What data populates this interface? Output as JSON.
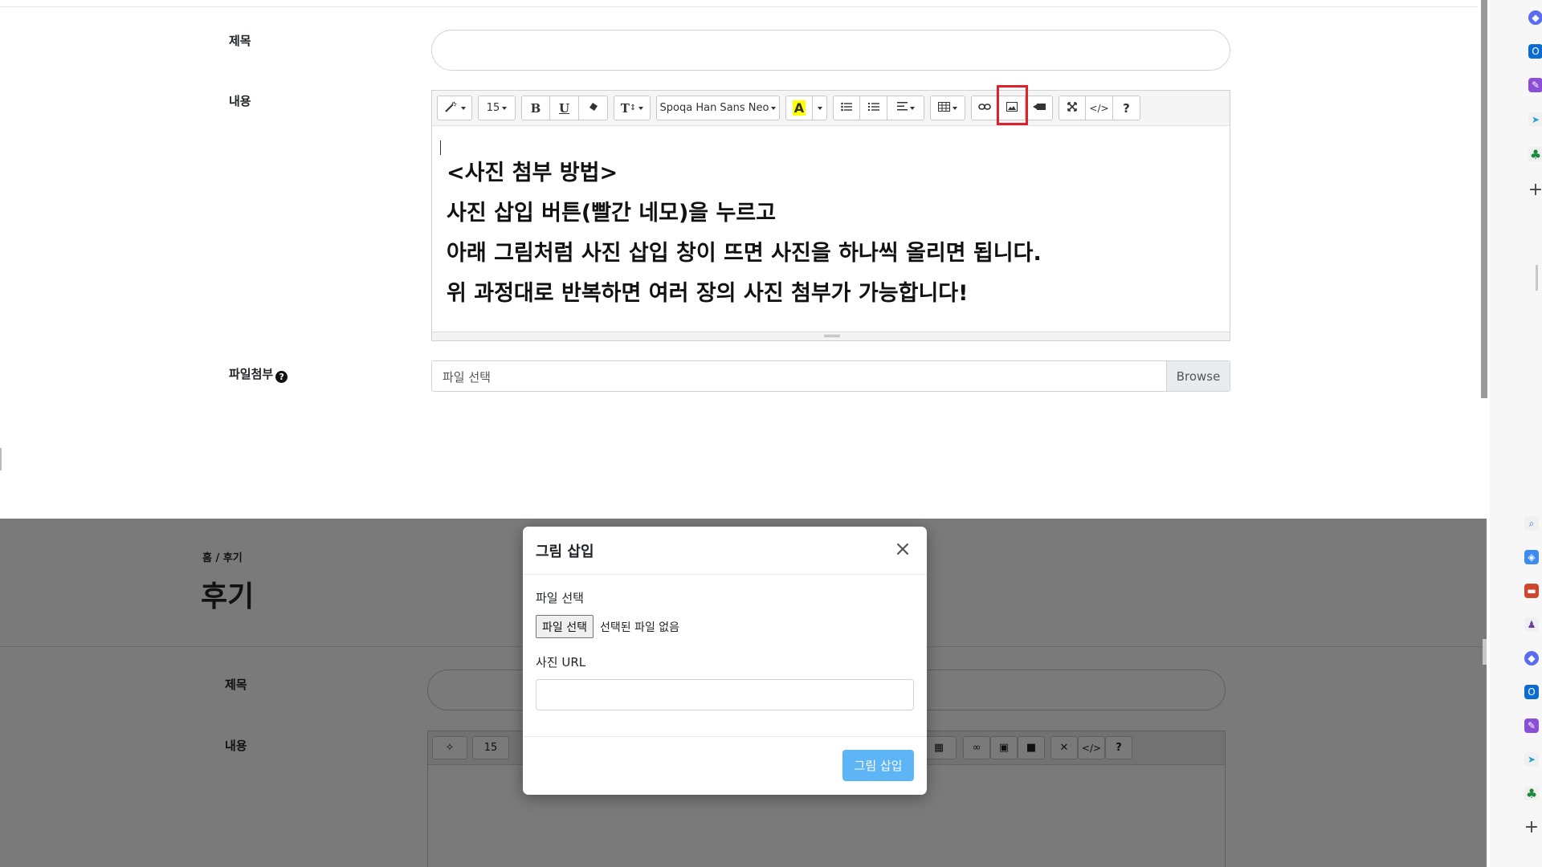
{
  "top": {
    "labels": {
      "title": "제목",
      "content": "내용",
      "attachment": "파일첨부"
    },
    "toolbar": {
      "font_size": "15",
      "bold": "B",
      "underline": "U",
      "text_size": "T",
      "font_name": "Spoqa Han Sans Neo",
      "color": "A",
      "help": "?"
    },
    "content_lines": [
      "<사진 첨부 방법>",
      "사진 삽입 버튼(빨간 네모)을 누르고",
      "아래 그림처럼 사진 삽입 창이 뜨면 사진을 하나씩 올리면 됩니다.",
      "위 과정대로 반복하면 여러 장의 사진 첨부가 가능합니다!"
    ],
    "file_placeholder": "파일 선택",
    "browse_label": "Browse",
    "help_mark": "?"
  },
  "bottom": {
    "breadcrumb": "홈 / 후기",
    "page_title": "후기",
    "labels": {
      "title": "제목",
      "content": "내용"
    },
    "toolbar": {
      "font_size": "15",
      "help": "?"
    }
  },
  "modal": {
    "title": "그림 삽입",
    "close": "×",
    "file_label": "파일 선택",
    "file_button": "파일 선택",
    "file_none": "선택된 파일 없음",
    "url_label": "사진 URL",
    "insert_button": "그림 삽입"
  },
  "colors": {
    "highlight": "#e0202a",
    "primary_button": "#5eb5f5",
    "overlay": "#7a7a7a"
  }
}
